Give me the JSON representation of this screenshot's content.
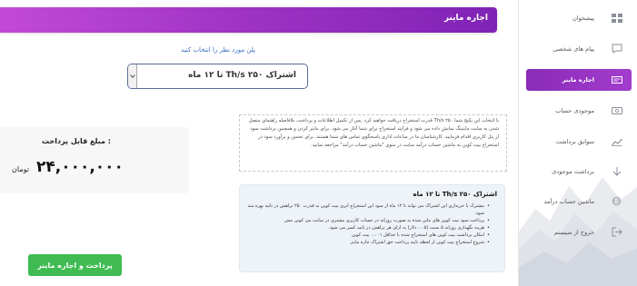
{
  "header": {
    "title": "اجاره ماینر"
  },
  "plan": {
    "label": "پلن مورد نظر را انتخاب کنید",
    "selected": "اشتراک ۲۵۰ Th/s تا ۱۲ ماه"
  },
  "price": {
    "title": "مبلغ قابل پرداخت :",
    "amount": "۲۴,۰۰۰,۰۰۰",
    "unit": "تومان"
  },
  "pay_button": {
    "label": "پرداخت و اجاره ماینر"
  },
  "description": {
    "text": "با انتخاب این پکیج شما ۲۵۰ Th/s قدرت استخراج دریافت خواهید کرد. پس از تکمیل اطلاعات و پرداخت، بلافاصله راهنمای متصل شدن به سایت ماینینگ نمایش داده می شود و فرآیند استخراج برای شما آغاز می شود. برای ماینر کردن و همچنین برداشت سود از پنل کاربری اقدام فرمایید. کارشناسان ما در ساعات اداری پاسخگوی تماس های شما هستند. برای تخمین و برآورد سود در استخراج بیت کوین به ماشین حساب درآمد سایت در منوی \"ماشین حساب درآمد\" مراجعه نمایید."
  },
  "card": {
    "title": "اشتراک ۲۵۰ Th/s تا ۱۲ ماه",
    "items": [
      "مشترک با خریداری این اشتراک می تواند تا ۱۲ ماه از سود این استخراج ابری بیت کوین به قدرت ۲۵۰ تراهش در ثانیه بهره مند شود.",
      "پرداخت سود بیت کوین های ماین شده به صورت روزانه در حساب کاربری مشتری در سایت می کوین مش",
      "هزینه نگهداری روزانه ۵ سنت (۰.۰۵ دلار) به ازای هر تراهش در ثانیه کسر می شود.",
      "امکان برداشت بیت کوین های استخراج شده با حداقل ۰.۰۰۱ بیت کوین",
      "شروع استخراج بیت کوین از لحظه تایید پرداخت حق اشتراک جاره ماینر"
    ]
  },
  "sidebar": {
    "items": [
      {
        "label": "پیشخوان",
        "icon": "dashboard-icon"
      },
      {
        "label": "پیام های شخصی",
        "icon": "message-icon"
      },
      {
        "label": "اجاره ماینر",
        "icon": "miner-icon",
        "active": true
      },
      {
        "label": "موجودی حساب",
        "icon": "wallet-icon"
      },
      {
        "label": "سوابق برداشت",
        "icon": "chart-icon"
      },
      {
        "label": "برداشت موجودی",
        "icon": "withdraw-icon"
      },
      {
        "label": "ماشین حساب درآمد",
        "icon": "calculator-icon"
      },
      {
        "label": "خروج از سیستم",
        "icon": "logout-icon"
      }
    ]
  },
  "colors": {
    "accent": "#9e32c4",
    "pay_button": "#3fbb52",
    "link": "#3a6fbf"
  }
}
